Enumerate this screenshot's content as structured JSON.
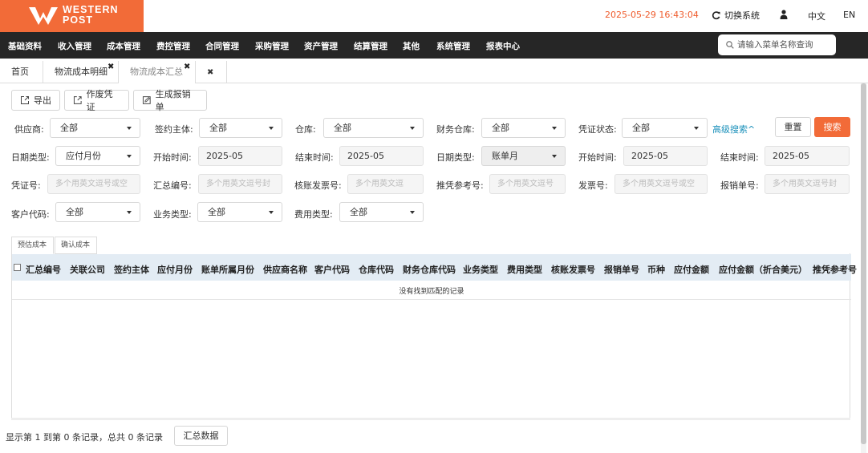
{
  "brand": {
    "logo_line1": "WESTERN",
    "logo_line2": "POST",
    "color": "#f26b38"
  },
  "header": {
    "datetime": "2025-05-29 16:43:04",
    "switch_system": "切换系统",
    "lang_zh": "中文",
    "lang_en": "EN"
  },
  "nav": {
    "items": [
      "基础资料",
      "收入管理",
      "成本管理",
      "费控管理",
      "合同管理",
      "采购管理",
      "资产管理",
      "结算管理",
      "其他",
      "系统管理",
      "报表中心"
    ],
    "search_placeholder": "请输入菜单名称查询"
  },
  "tabs": [
    {
      "label": "首页"
    },
    {
      "label": "物流成本明细"
    },
    {
      "label": "物流成本汇总"
    }
  ],
  "toolbar": {
    "export": "导出",
    "void_voucher": "作废凭证",
    "gen_reimburse": "生成报销单"
  },
  "filters": {
    "supplier": {
      "label": "供应商:",
      "value": "全部"
    },
    "signing_entity": {
      "label": "签约主体:",
      "value": "全部"
    },
    "warehouse": {
      "label": "仓库:",
      "value": "全部"
    },
    "finance_warehouse": {
      "label": "财务仓库:",
      "value": "全部"
    },
    "voucher_status": {
      "label": "凭证状态:",
      "value": "全部"
    },
    "advanced": "高级搜索^",
    "reset": "重置",
    "search": "搜索",
    "date_type1": {
      "label": "日期类型:",
      "value": "应付月份"
    },
    "start1": {
      "label": "开始时间:",
      "value": "2025-05"
    },
    "end1": {
      "label": "结束时间:",
      "value": "2025-05"
    },
    "date_type2": {
      "label": "日期类型:",
      "value": "账单月"
    },
    "start2": {
      "label": "开始时间:",
      "value": "2025-05"
    },
    "end2": {
      "label": "结束时间:",
      "value": "2025-05"
    },
    "voucher_no": {
      "label": "凭证号:",
      "placeholder": "多个用英文逗号或空"
    },
    "summary_no": {
      "label": "汇总编号:",
      "placeholder": "多个用英文逗号封"
    },
    "verify_invoice": {
      "label": "核账发票号:",
      "placeholder": "多个用英文逗"
    },
    "push_ref": {
      "label": "推凭参考号:",
      "placeholder": "多个用英文逗号"
    },
    "invoice_no": {
      "label": "发票号:",
      "placeholder": "多个用英文逗号或空"
    },
    "reimburse_no": {
      "label": "报销单号:",
      "placeholder": "多个用英文逗号封"
    },
    "customer_code": {
      "label": "客户代码:",
      "value": "全部"
    },
    "business_type": {
      "label": "业务类型:",
      "value": "全部"
    },
    "fee_type": {
      "label": "费用类型:",
      "value": "全部"
    }
  },
  "subtabs": {
    "estimated": "预估成本",
    "confirmed": "确认成本"
  },
  "table": {
    "columns": [
      "汇总编号",
      "关联公司",
      "签约主体",
      "应付月份",
      "账单所属月份",
      "供应商名称",
      "客户代码",
      "仓库代码",
      "财务仓库代码",
      "业务类型",
      "费用类型",
      "核账发票号",
      "报销单号",
      "币种",
      "应付金额",
      "应付金额（折合美元）",
      "推凭参考号"
    ],
    "empty_text": "没有找到匹配的记录"
  },
  "footer": {
    "info": "显示第 1 到第 0 条记录，总共 0 条记录",
    "summary_button": "汇总数据"
  }
}
